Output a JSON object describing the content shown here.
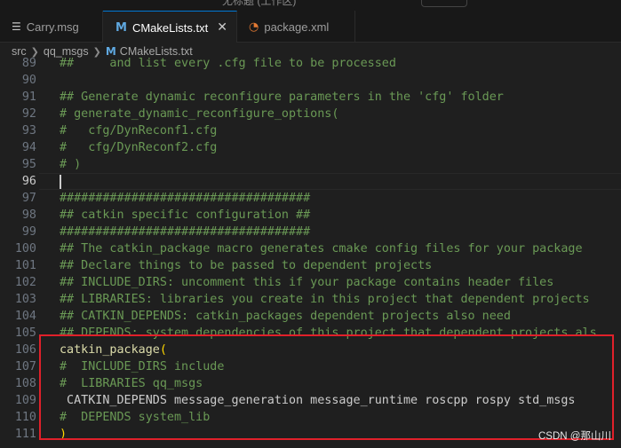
{
  "tabs": [
    {
      "label": "Carry.msg",
      "icon": "lines-icon",
      "active": false
    },
    {
      "label": "CMakeLists.txt",
      "icon": "cmake-icon",
      "active": true
    },
    {
      "label": "package.xml",
      "icon": "rss-icon",
      "active": false
    }
  ],
  "breadcrumb": [
    "src",
    "qq_msgs",
    "CMakeLists.txt"
  ],
  "lines": [
    {
      "n": "89",
      "text": "##     and list every .cfg file to be processed"
    },
    {
      "n": "90",
      "text": ""
    },
    {
      "n": "91",
      "text": "## Generate dynamic reconfigure parameters in the 'cfg' folder"
    },
    {
      "n": "92",
      "text": "# generate_dynamic_reconfigure_options("
    },
    {
      "n": "93",
      "text": "#   cfg/DynReconf1.cfg"
    },
    {
      "n": "94",
      "text": "#   cfg/DynReconf2.cfg"
    },
    {
      "n": "95",
      "text": "# )"
    },
    {
      "n": "96",
      "text": ""
    },
    {
      "n": "97",
      "text": "###################################"
    },
    {
      "n": "98",
      "text": "## catkin specific configuration ##"
    },
    {
      "n": "99",
      "text": "###################################"
    },
    {
      "n": "100",
      "text": "## The catkin_package macro generates cmake config files for your package"
    },
    {
      "n": "101",
      "text": "## Declare things to be passed to dependent projects"
    },
    {
      "n": "102",
      "text": "## INCLUDE_DIRS: uncomment this if your package contains header files"
    },
    {
      "n": "103",
      "text": "## LIBRARIES: libraries you create in this project that dependent projects"
    },
    {
      "n": "104",
      "text": "## CATKIN_DEPENDS: catkin_packages dependent projects also need"
    },
    {
      "n": "105",
      "text": "## DEPENDS: system dependencies of this project that dependent projects als"
    },
    {
      "n": "106",
      "fn": "catkin_package",
      "paren": "("
    },
    {
      "n": "107",
      "text": "#  INCLUDE_DIRS include"
    },
    {
      "n": "108",
      "text": "#  LIBRARIES qq_msgs"
    },
    {
      "n": "109",
      "text": " CATKIN_DEPENDS message_generation message_runtime roscpp rospy std_msgs",
      "plain": true
    },
    {
      "n": "110",
      "text": "#  DEPENDS system_lib"
    },
    {
      "n": "111",
      "paren": ")"
    }
  ],
  "current_line": "96",
  "watermark": "CSDN @那山川",
  "titlebar_text": "无标题 (工作区)",
  "colors": {
    "comment": "#6a9955",
    "function": "#dcdcaa",
    "bracket": "#ffd700",
    "highlight_box": "#e0202a",
    "tab_accent": "#0078d4"
  }
}
